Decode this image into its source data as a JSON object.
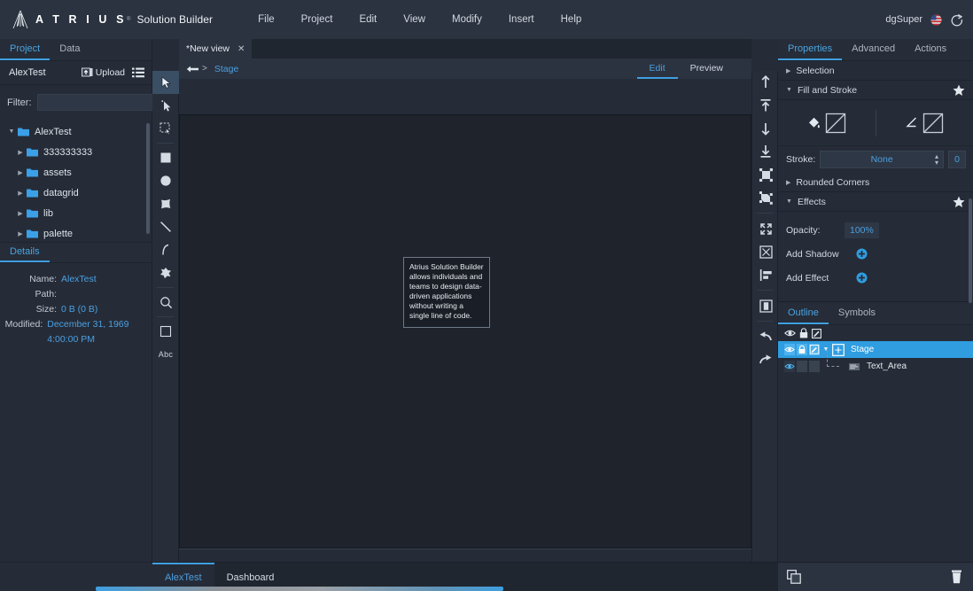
{
  "app": {
    "brand": "A T R I U S",
    "brand_tm": "®",
    "brand_sub": "Solution Builder",
    "logo_icon": "atrius-a-logo",
    "menu": [
      {
        "label": "File"
      },
      {
        "label": "Project"
      },
      {
        "label": "Edit"
      },
      {
        "label": "View"
      },
      {
        "label": "Modify"
      },
      {
        "label": "Insert"
      },
      {
        "label": "Help"
      }
    ],
    "user": "dgSuper",
    "flag_icon": "us-flag-icon",
    "logout_icon": "logout-icon"
  },
  "left_panel": {
    "tabs": [
      {
        "label": "Project",
        "active": true
      },
      {
        "label": "Data",
        "active": false
      }
    ],
    "project_name": "AlexTest",
    "upload_label": "Upload",
    "upload_icon": "upload-icon",
    "list_menu_icon": "hamburger-icon",
    "filter_label": "Filter:",
    "filter_value": "",
    "filter_placeholder": "",
    "tree": [
      {
        "label": "AlexTest",
        "depth": 0,
        "expanded": true
      },
      {
        "label": "333333333",
        "depth": 1,
        "expanded": false
      },
      {
        "label": "assets",
        "depth": 1,
        "expanded": false
      },
      {
        "label": "datagrid",
        "depth": 1,
        "expanded": false
      },
      {
        "label": "lib",
        "depth": 1,
        "expanded": false
      },
      {
        "label": "palette",
        "depth": 1,
        "expanded": false
      }
    ],
    "details": {
      "tab_label": "Details",
      "rows": [
        {
          "key": "Name:",
          "value": "AlexTest"
        },
        {
          "key": "Path:",
          "value": ""
        },
        {
          "key": "Size:",
          "value": "0 B (0 B)"
        },
        {
          "key": "Modified:",
          "value": "December 31, 1969 4:00:00 PM"
        }
      ]
    }
  },
  "tool_palette": [
    {
      "icon": "select-arrow-icon",
      "active": true
    },
    {
      "icon": "direct-select-icon",
      "active": false
    },
    {
      "icon": "marquee-select-icon",
      "active": false
    },
    {
      "icon": "rectangle-tool-icon",
      "active": false
    },
    {
      "icon": "ellipse-tool-icon",
      "active": false
    },
    {
      "icon": "polygon-tool-icon",
      "active": false
    },
    {
      "icon": "line-tool-icon",
      "active": false
    },
    {
      "icon": "arc-tool-icon",
      "active": false
    },
    {
      "icon": "freeform-tool-icon",
      "active": false
    },
    {
      "icon": "zoom-tool-icon",
      "active": false
    },
    {
      "icon": "frame-tool-icon",
      "active": false
    },
    {
      "icon": "text-tool-icon",
      "active": false,
      "label": "Abc"
    }
  ],
  "center": {
    "view_tab": {
      "label": "*New view",
      "close_icon": "close-icon"
    },
    "breadcrumb": {
      "back_icon": "back-arrow-icon",
      "separator": ">",
      "items": [
        {
          "label": "Stage"
        }
      ]
    },
    "mode_tabs": [
      {
        "label": "Edit",
        "active": true
      },
      {
        "label": "Preview",
        "active": false
      }
    ],
    "stage": {
      "text_area": {
        "name": "Text_Area",
        "text": "Atrius Solution Builder allows individuals and teams to design data-driven applications without writing a single line of code."
      }
    }
  },
  "right_strip": [
    {
      "icon": "bring-forward-icon"
    },
    {
      "icon": "bring-to-front-icon"
    },
    {
      "icon": "send-backward-icon"
    },
    {
      "icon": "send-to-back-icon"
    },
    {
      "icon": "group-icon"
    },
    {
      "icon": "ungroup-icon"
    },
    {
      "icon": "fit-to-screen-icon"
    },
    {
      "icon": "center-align-icon"
    },
    {
      "icon": "align-left-icon"
    },
    {
      "icon": "distribute-icon"
    },
    {
      "icon": "undo-icon"
    },
    {
      "icon": "redo-icon"
    }
  ],
  "right_panel": {
    "tabs": [
      {
        "label": "Properties",
        "active": true
      },
      {
        "label": "Advanced",
        "active": false
      },
      {
        "label": "Actions",
        "active": false
      }
    ],
    "sections": {
      "selection": {
        "label": "Selection",
        "expanded": false
      },
      "fill_and_stroke": {
        "label": "Fill and Stroke",
        "expanded": true,
        "fill_icon": "paint-bucket-icon",
        "fill_swatch_icon": "no-color-swatch-icon",
        "stroke_icon": "stroke-pen-icon",
        "stroke_swatch_icon": "no-color-swatch-icon",
        "stroke_label": "Stroke:",
        "stroke_value": "None",
        "stroke_width": "0"
      },
      "rounded_corners": {
        "label": "Rounded Corners",
        "expanded": false
      },
      "effects": {
        "label": "Effects",
        "expanded": true,
        "opacity_label": "Opacity:",
        "opacity_value": "100%",
        "add_shadow_label": "Add Shadow",
        "add_effect_label": "Add Effect",
        "plus_icon": "plus-circle-icon"
      }
    },
    "outline": {
      "tabs": [
        {
          "label": "Outline",
          "active": true
        },
        {
          "label": "Symbols",
          "active": false
        }
      ],
      "header_icons": [
        "eye-icon",
        "lock-icon",
        "edit-icon"
      ],
      "rows": [
        {
          "label": "Stage",
          "selected": true,
          "depth": 0,
          "node_icon": "stage-node-icon",
          "expanded": true
        },
        {
          "label": "Text_Area",
          "selected": false,
          "depth": 1,
          "node_icon": "text-node-icon",
          "expanded": false
        }
      ]
    }
  },
  "bottom": {
    "tabs": [
      {
        "label": "AlexTest",
        "active": true
      },
      {
        "label": "Dashboard",
        "active": false
      }
    ],
    "duplicate_icon": "duplicate-icon",
    "delete_icon": "trash-icon"
  },
  "colors": {
    "accent": "#3f9fe0",
    "link": "#4c9fe0",
    "panel_bg": "#252c38",
    "bar_bg": "#2b3340",
    "stage_bg": "#1e232c",
    "selected_row": "#2f9de0"
  }
}
